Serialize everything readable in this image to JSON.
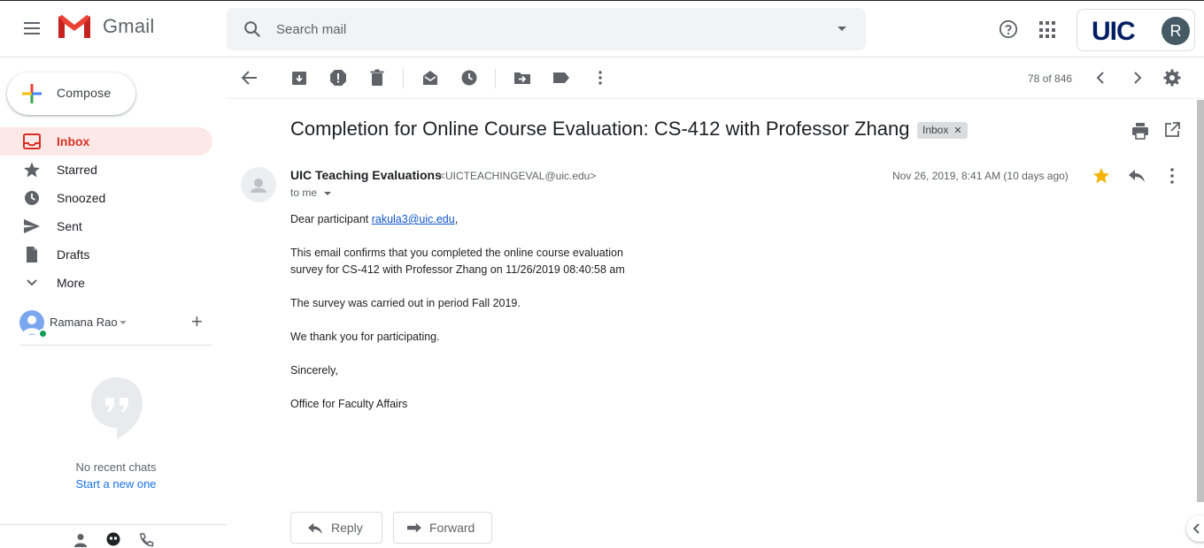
{
  "app": {
    "name": "Gmail"
  },
  "account": {
    "org_logo_text": "UIC",
    "avatar_initial": "R"
  },
  "search": {
    "placeholder": "Search mail"
  },
  "sidebar": {
    "compose_label": "Compose",
    "items": [
      {
        "label": "Inbox",
        "icon": "inbox-icon",
        "active": true
      },
      {
        "label": "Starred",
        "icon": "star-icon"
      },
      {
        "label": "Snoozed",
        "icon": "clock-icon"
      },
      {
        "label": "Sent",
        "icon": "send-icon"
      },
      {
        "label": "Drafts",
        "icon": "draft-icon"
      },
      {
        "label": "More",
        "icon": "chevron-down-icon"
      }
    ],
    "hangouts_user": "Ramana Rao",
    "no_chats": "No recent chats",
    "start_new": "Start a new one"
  },
  "toolbar": {
    "pager": "78 of 846"
  },
  "message": {
    "subject": "Completion for Online Course Evaluation: CS-412 with Professor Zhang",
    "label": "Inbox",
    "sender_name": "UIC Teaching Evaluations",
    "sender_email": "<UICTEACHINGEVAL@uic.edu>",
    "recipient": "to me",
    "date": "Nov 26, 2019, 8:41 AM (10 days ago)",
    "body": {
      "greeting_prefix": "Dear participant ",
      "greeting_link": "rakula3@uic.edu",
      "greeting_suffix": ",",
      "line1": "This email confirms that you completed the online course evaluation",
      "line2": "survey for CS-412 with Professor Zhang on 11/26/2019 08:40:58 am",
      "para2": "The survey was carried out in period Fall 2019.",
      "para3": "We thank you for participating.",
      "para4": "Sincerely,",
      "para5": "Office for Faculty Affairs"
    }
  },
  "actions": {
    "reply": "Reply",
    "forward": "Forward"
  },
  "colors": {
    "accent_red": "#d93025",
    "active_bg": "#fce8e6",
    "link": "#1155cc",
    "star": "#f4b400"
  }
}
